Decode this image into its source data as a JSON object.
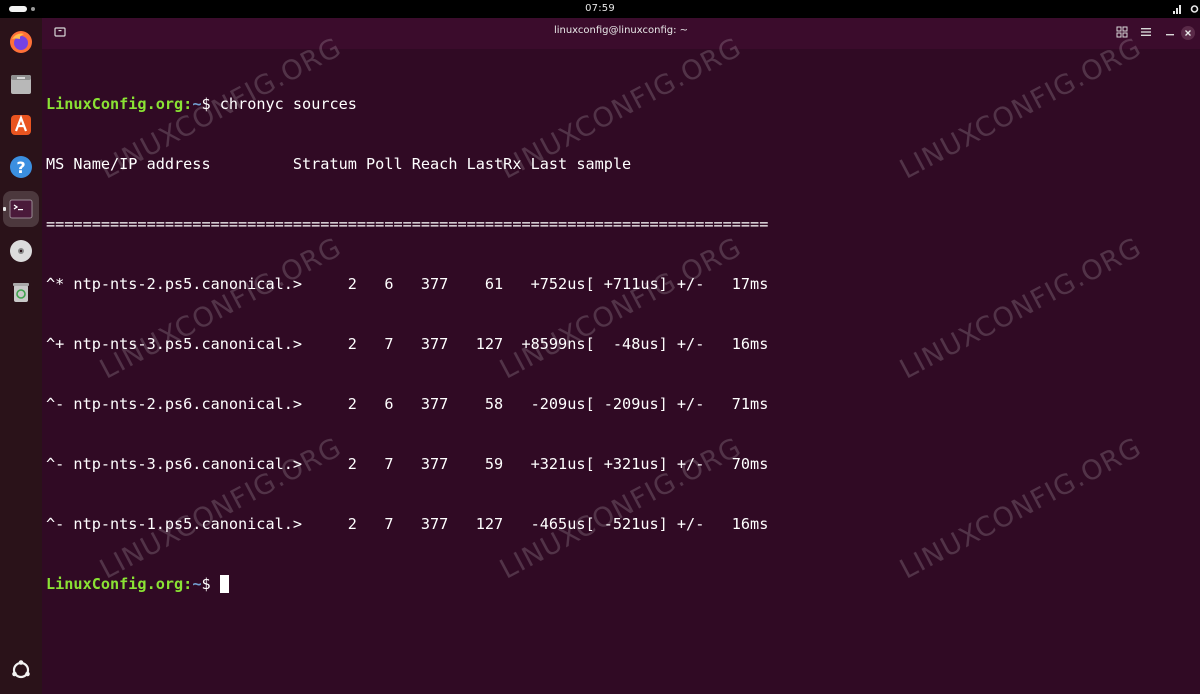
{
  "topbar": {
    "clock": "07:59",
    "tray_icons": [
      "network-icon",
      "settings-icon"
    ]
  },
  "dock": {
    "items": [
      {
        "name": "firefox",
        "icon": "firefox-icon",
        "running": false
      },
      {
        "name": "files",
        "icon": "files-icon",
        "running": false
      },
      {
        "name": "app-center",
        "icon": "app-center-icon",
        "running": false
      },
      {
        "name": "help",
        "icon": "help-icon",
        "running": false
      },
      {
        "name": "terminal",
        "icon": "terminal-icon",
        "running": true,
        "active": true
      },
      {
        "name": "disc",
        "icon": "disc-icon",
        "running": false
      },
      {
        "name": "trash",
        "icon": "trash-icon",
        "running": false
      }
    ],
    "bottom_icon": "ubuntu-logo-icon"
  },
  "window": {
    "title": "linuxconfig@linuxconfig: ~",
    "buttons": [
      "new-tab",
      "layout",
      "menu",
      "minimize",
      "close"
    ]
  },
  "terminal": {
    "prompt_host": "LinuxConfig.org",
    "prompt_path": "~",
    "prompt_suffix": "$ ",
    "command": "chronyc sources",
    "header": "MS Name/IP address         Stratum Poll Reach LastRx Last sample",
    "separator": "===============================================================================",
    "rows": [
      "^* ntp-nts-2.ps5.canonical.>     2   6   377    61   +752us[ +711us] +/-   17ms",
      "^+ ntp-nts-3.ps5.canonical.>     2   7   377   127  +8599ns[  -48us] +/-   16ms",
      "^- ntp-nts-2.ps6.canonical.>     2   6   377    58   -209us[ -209us] +/-   71ms",
      "^- ntp-nts-3.ps6.canonical.>     2   7   377    59   +321us[ +321us] +/-   70ms",
      "^- ntp-nts-1.ps5.canonical.>     2   7   377   127   -465us[ -521us] +/-   16ms"
    ],
    "colors": {
      "background": "#300a24",
      "prompt_host": "#8ae234",
      "prompt_path": "#729fcf",
      "text": "#ffffff"
    }
  },
  "watermark": "LINUXCONFIG.ORG"
}
